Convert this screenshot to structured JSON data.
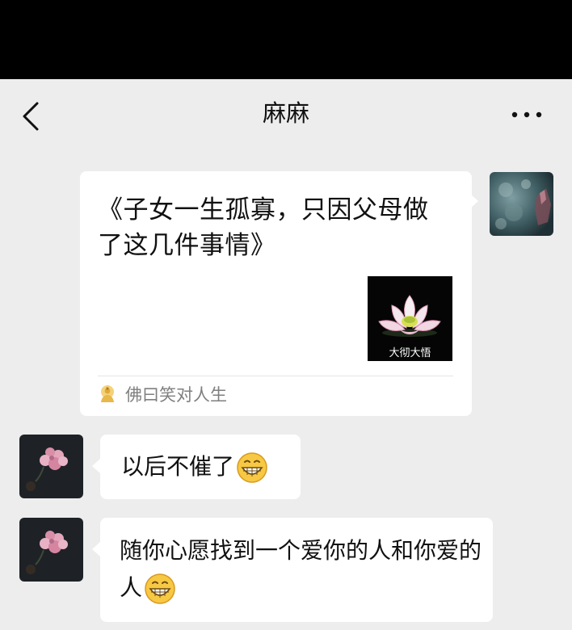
{
  "header": {
    "title": "麻麻"
  },
  "shared_card": {
    "title": "《子女一生孤寡，只因父母做了这几件事情》",
    "thumbnail_caption": "大彻大悟",
    "source": "佛曰笑对人生"
  },
  "messages": [
    {
      "text": "以后不催了",
      "emoji": "grinning-face"
    },
    {
      "text": "随你心愿找到一个爱你的人和你爱的人",
      "emoji": "grinning-face"
    }
  ],
  "colors": {
    "status_bar": "#000000",
    "background": "#ededed",
    "bubble": "#ffffff",
    "source_text": "#7f7f7f"
  },
  "icons": {
    "back": "chevron-left-icon",
    "more": "more-dots-icon",
    "source": "buddha-icon",
    "emoji": "grinning-face-icon"
  }
}
